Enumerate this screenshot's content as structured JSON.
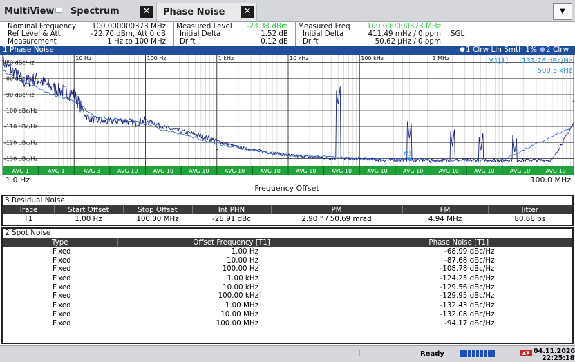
{
  "tabs": [
    {
      "label": "MultiView"
    },
    {
      "label": "Spectrum"
    },
    {
      "label": "Phase Noise"
    }
  ],
  "info": {
    "col1_labels": [
      "Nominal Frequency",
      "Ref Level & Att",
      "Measurement"
    ],
    "col1_values": [
      "100.000000373 MHz",
      "-22.70 dBm, Att 0 dB",
      "1 Hz to 100 MHz"
    ],
    "col2_labels": [
      "Measured Level",
      "Initial Delta",
      "Drift"
    ],
    "col2_values": [
      "-23.33 dBm",
      "1.52 dB",
      "0.12 dB"
    ],
    "col3_labels": [
      "Measured Freq",
      "Initial Delta",
      "Drift"
    ],
    "col3_values": [
      "100.000000373 MHz",
      "411.49 mHz / 0 ppm",
      "50.62 µHz / 0 ppm"
    ],
    "sweep": "SGL",
    "accent_green": "#2ecc40"
  },
  "phase_noise_window": {
    "title": "1 Phase Noise",
    "trace1_legend": "1 Clrw Lin Smth 1%",
    "trace2_legend": "2 Clrw",
    "marker_label": "M1[1]",
    "marker_value": "-131.76 dBc/Hz",
    "marker_freq": "500.5 kHz",
    "marker_tag": "M1",
    "x_start": "1.0 Hz",
    "x_stop": "100.0 MHz",
    "x_title": "Frequency Offset",
    "decades": [
      "10 Hz",
      "100 Hz",
      "1 kHz",
      "10 kHz",
      "100 kHz",
      "1 MHz"
    ],
    "y_ticks": [
      "-80 dBc/Hz",
      "-90 dBc/Hz",
      "-100 dBc/Hz",
      "-110 dBc/Hz",
      "-120 dBc/Hz",
      "-130 dBc/Hz"
    ],
    "y_top_tick": "-70 dBc/Hz",
    "avg_labels": [
      "AVG 1",
      "AVG 1",
      "AVG 3",
      "AVG 10",
      "AVG 10",
      "AVG 10",
      "AVG 10",
      "AVG 10",
      "AVG 10",
      "AVG 10",
      "AVG 10",
      "AVG 10",
      "AVG 10",
      "AVG 10",
      "AVG 10",
      "AVG 10"
    ]
  },
  "chart_data": {
    "type": "line",
    "title": "1 Phase Noise",
    "xlabel": "Frequency Offset",
    "ylabel": "",
    "x_scale": "log",
    "xlim": [
      1,
      100000000
    ],
    "ylim": [
      -135,
      -65
    ],
    "grid": true,
    "series": [
      {
        "name": "1 Clrw Lin Smth 1%",
        "color": "#1a237e",
        "x": [
          1,
          1.5,
          2,
          3,
          5,
          7,
          10,
          15,
          20,
          30,
          50,
          70,
          100,
          200,
          500,
          1000,
          2000,
          5000,
          10000,
          20000,
          50000,
          100000,
          200000,
          500000,
          1000000,
          2000000,
          5000000,
          10000000,
          20000000,
          50000000,
          100000000
        ],
        "y": [
          -69,
          -77,
          -82,
          -80,
          -86,
          -88,
          -90,
          -104,
          -106,
          -107,
          -106,
          -108,
          -106,
          -111,
          -115,
          -119,
          -123,
          -126,
          -128,
          -129,
          -130,
          -130,
          -131,
          -131,
          -131,
          -131,
          -131,
          -131,
          -131,
          -131,
          -108
        ]
      },
      {
        "name": "2 Clrw",
        "color": "#3366cc",
        "x": [
          1,
          2,
          5,
          10,
          20,
          50,
          100,
          200,
          500,
          1000,
          5000,
          10000,
          100000,
          1000000,
          10000000,
          100000000
        ],
        "y": [
          -75,
          -82,
          -90,
          -94,
          -104,
          -106,
          -108,
          -113,
          -117,
          -121,
          -126,
          -128,
          -130,
          -131,
          -131,
          -110
        ]
      }
    ],
    "spots": [
      {
        "x": 1,
        "y": -68.99
      },
      {
        "x": 10,
        "y": -87.68
      },
      {
        "x": 100,
        "y": -108.78
      },
      {
        "x": 1000,
        "y": -124.25
      },
      {
        "x": 10000,
        "y": -129.56
      },
      {
        "x": 100000,
        "y": -129.95
      },
      {
        "x": 1000000,
        "y": -132.43
      },
      {
        "x": 10000000,
        "y": -132.08
      },
      {
        "x": 100000000,
        "y": -94.17
      }
    ],
    "spurs": [
      {
        "x": 50000,
        "y": -97
      },
      {
        "x": 500500,
        "y": -118
      },
      {
        "x": 2000000,
        "y": -123
      },
      {
        "x": 5000000,
        "y": -126
      },
      {
        "x": 15000000,
        "y": -127
      }
    ],
    "marker": {
      "x": 500500,
      "y": -131.76
    }
  },
  "residual_noise": {
    "title": "3 Residual Noise",
    "headers": [
      "Trace",
      "Start Offset",
      "Stop Offset",
      "Int PHN",
      "PM",
      "FM",
      "Jitter"
    ],
    "row": [
      "T1",
      "1.00 Hz",
      "100.00 MHz",
      "-28.91 dBc",
      "2.90 ° / 50.69 mrad",
      "4.94 MHz",
      "80.68 ps"
    ]
  },
  "spot_noise": {
    "title": "2 Spot Noise",
    "headers": [
      "Type",
      "Offset Frequency [T1]",
      "Phase Noise [T1]"
    ],
    "rows": [
      [
        "Fixed",
        "1.00 Hz",
        "-68.99 dBc/Hz"
      ],
      [
        "Fixed",
        "10.00 Hz",
        "-87.68 dBc/Hz"
      ],
      [
        "Fixed",
        "100.00 Hz",
        "-108.78 dBc/Hz"
      ],
      [
        "Fixed",
        "1.00 kHz",
        "-124.25 dBc/Hz"
      ],
      [
        "Fixed",
        "10.00 kHz",
        "-129.56 dBc/Hz"
      ],
      [
        "Fixed",
        "100.00 kHz",
        "-129.95 dBc/Hz"
      ],
      [
        "Fixed",
        "1.00 MHz",
        "-132.43 dBc/Hz"
      ],
      [
        "Fixed",
        "10.00 MHz",
        "-132.08 dBc/Hz"
      ],
      [
        "Fixed",
        "100.00 MHz",
        "-94.17 dBc/Hz"
      ]
    ]
  },
  "status": {
    "state": "Ready",
    "date": "04.11.2020",
    "time": "22:25:18",
    "progress": 1.0
  }
}
